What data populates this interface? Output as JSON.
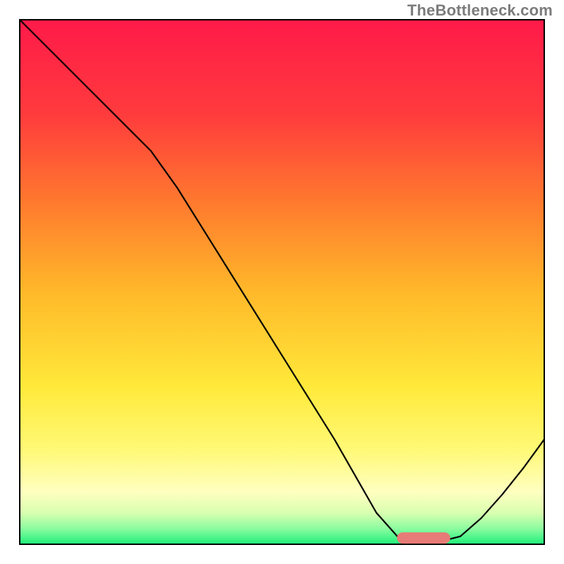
{
  "watermark": "TheBottleneck.com",
  "chart_data": {
    "type": "line",
    "title": "",
    "xlabel": "",
    "ylabel": "",
    "xlim": [
      0,
      100
    ],
    "ylim": [
      0,
      100
    ],
    "background_gradient": {
      "stops": [
        {
          "offset": 0.0,
          "color": "#ff1a49"
        },
        {
          "offset": 0.18,
          "color": "#ff3b3d"
        },
        {
          "offset": 0.35,
          "color": "#ff7a2e"
        },
        {
          "offset": 0.52,
          "color": "#ffb92a"
        },
        {
          "offset": 0.7,
          "color": "#ffe93a"
        },
        {
          "offset": 0.82,
          "color": "#fff976"
        },
        {
          "offset": 0.9,
          "color": "#ffffc0"
        },
        {
          "offset": 0.94,
          "color": "#d9ffb0"
        },
        {
          "offset": 0.97,
          "color": "#8cfca0"
        },
        {
          "offset": 1.0,
          "color": "#1ef07a"
        }
      ]
    },
    "series": [
      {
        "name": "curve",
        "stroke": "#000000",
        "stroke_width": 2.2,
        "marker": null,
        "points": [
          {
            "x": 0.0,
            "y": 100.0
          },
          {
            "x": 10.0,
            "y": 90.0
          },
          {
            "x": 20.0,
            "y": 80.0
          },
          {
            "x": 25.0,
            "y": 75.0
          },
          {
            "x": 30.0,
            "y": 68.0
          },
          {
            "x": 40.0,
            "y": 52.0
          },
          {
            "x": 50.0,
            "y": 36.0
          },
          {
            "x": 60.0,
            "y": 20.0
          },
          {
            "x": 68.0,
            "y": 6.0
          },
          {
            "x": 72.0,
            "y": 1.5
          },
          {
            "x": 76.0,
            "y": 0.5
          },
          {
            "x": 80.0,
            "y": 0.5
          },
          {
            "x": 84.0,
            "y": 1.5
          },
          {
            "x": 88.0,
            "y": 5.0
          },
          {
            "x": 92.0,
            "y": 9.5
          },
          {
            "x": 96.0,
            "y": 14.5
          },
          {
            "x": 100.0,
            "y": 20.0
          }
        ]
      },
      {
        "name": "marker-region",
        "stroke": "#e77b77",
        "stroke_width": 16,
        "marker": "bar",
        "points": [
          {
            "x": 73.0,
            "y": 1.2
          },
          {
            "x": 81.0,
            "y": 1.2
          }
        ]
      }
    ],
    "annotations": []
  }
}
